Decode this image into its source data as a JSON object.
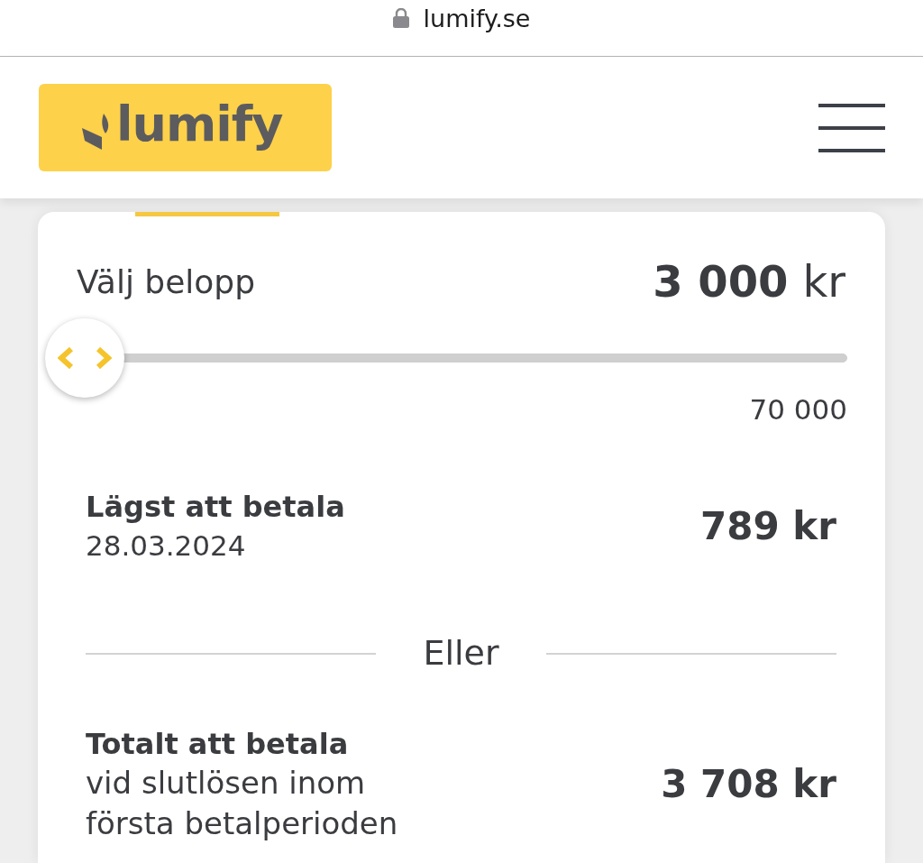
{
  "address_bar": {
    "url": "lumify.se",
    "secure": true
  },
  "header": {
    "logo": {
      "text": "lumify"
    }
  },
  "card": {
    "amount": {
      "label": "Välj belopp",
      "value": "3 000",
      "unit": "kr"
    },
    "slider": {
      "level": 0,
      "max_label": "70 000"
    },
    "lowest": {
      "title": "Lägst att betala",
      "date": "28.03.2024",
      "amount": "789 kr"
    },
    "divider": "Eller",
    "total": {
      "title": "Totalt att betala",
      "note": "vid slutlösen inom första betalperioden",
      "amount": "3 708 kr"
    }
  }
}
